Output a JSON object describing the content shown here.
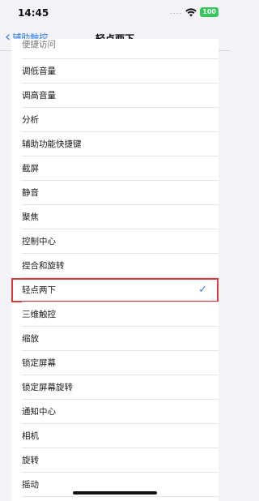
{
  "status_bar": {
    "time": "14:45",
    "signal_dots": "....",
    "battery": "100"
  },
  "nav": {
    "back_label": "辅助触控",
    "title": "轻点两下"
  },
  "list": {
    "items": [
      "便捷访问",
      "调低音量",
      "调高音量",
      "分析",
      "辅助功能快捷键",
      "截屏",
      "静音",
      "聚焦",
      "控制中心",
      "捏合和旋转",
      "轻点两下",
      "三维触控",
      "缩放",
      "锁定屏幕",
      "锁定屏幕旋转",
      "通知中心",
      "相机",
      "旋转",
      "摇动"
    ],
    "selected_check": "✓"
  },
  "colors": {
    "accent": "#2f7cf6",
    "highlight": "#d9393b",
    "battery": "#34c759"
  }
}
